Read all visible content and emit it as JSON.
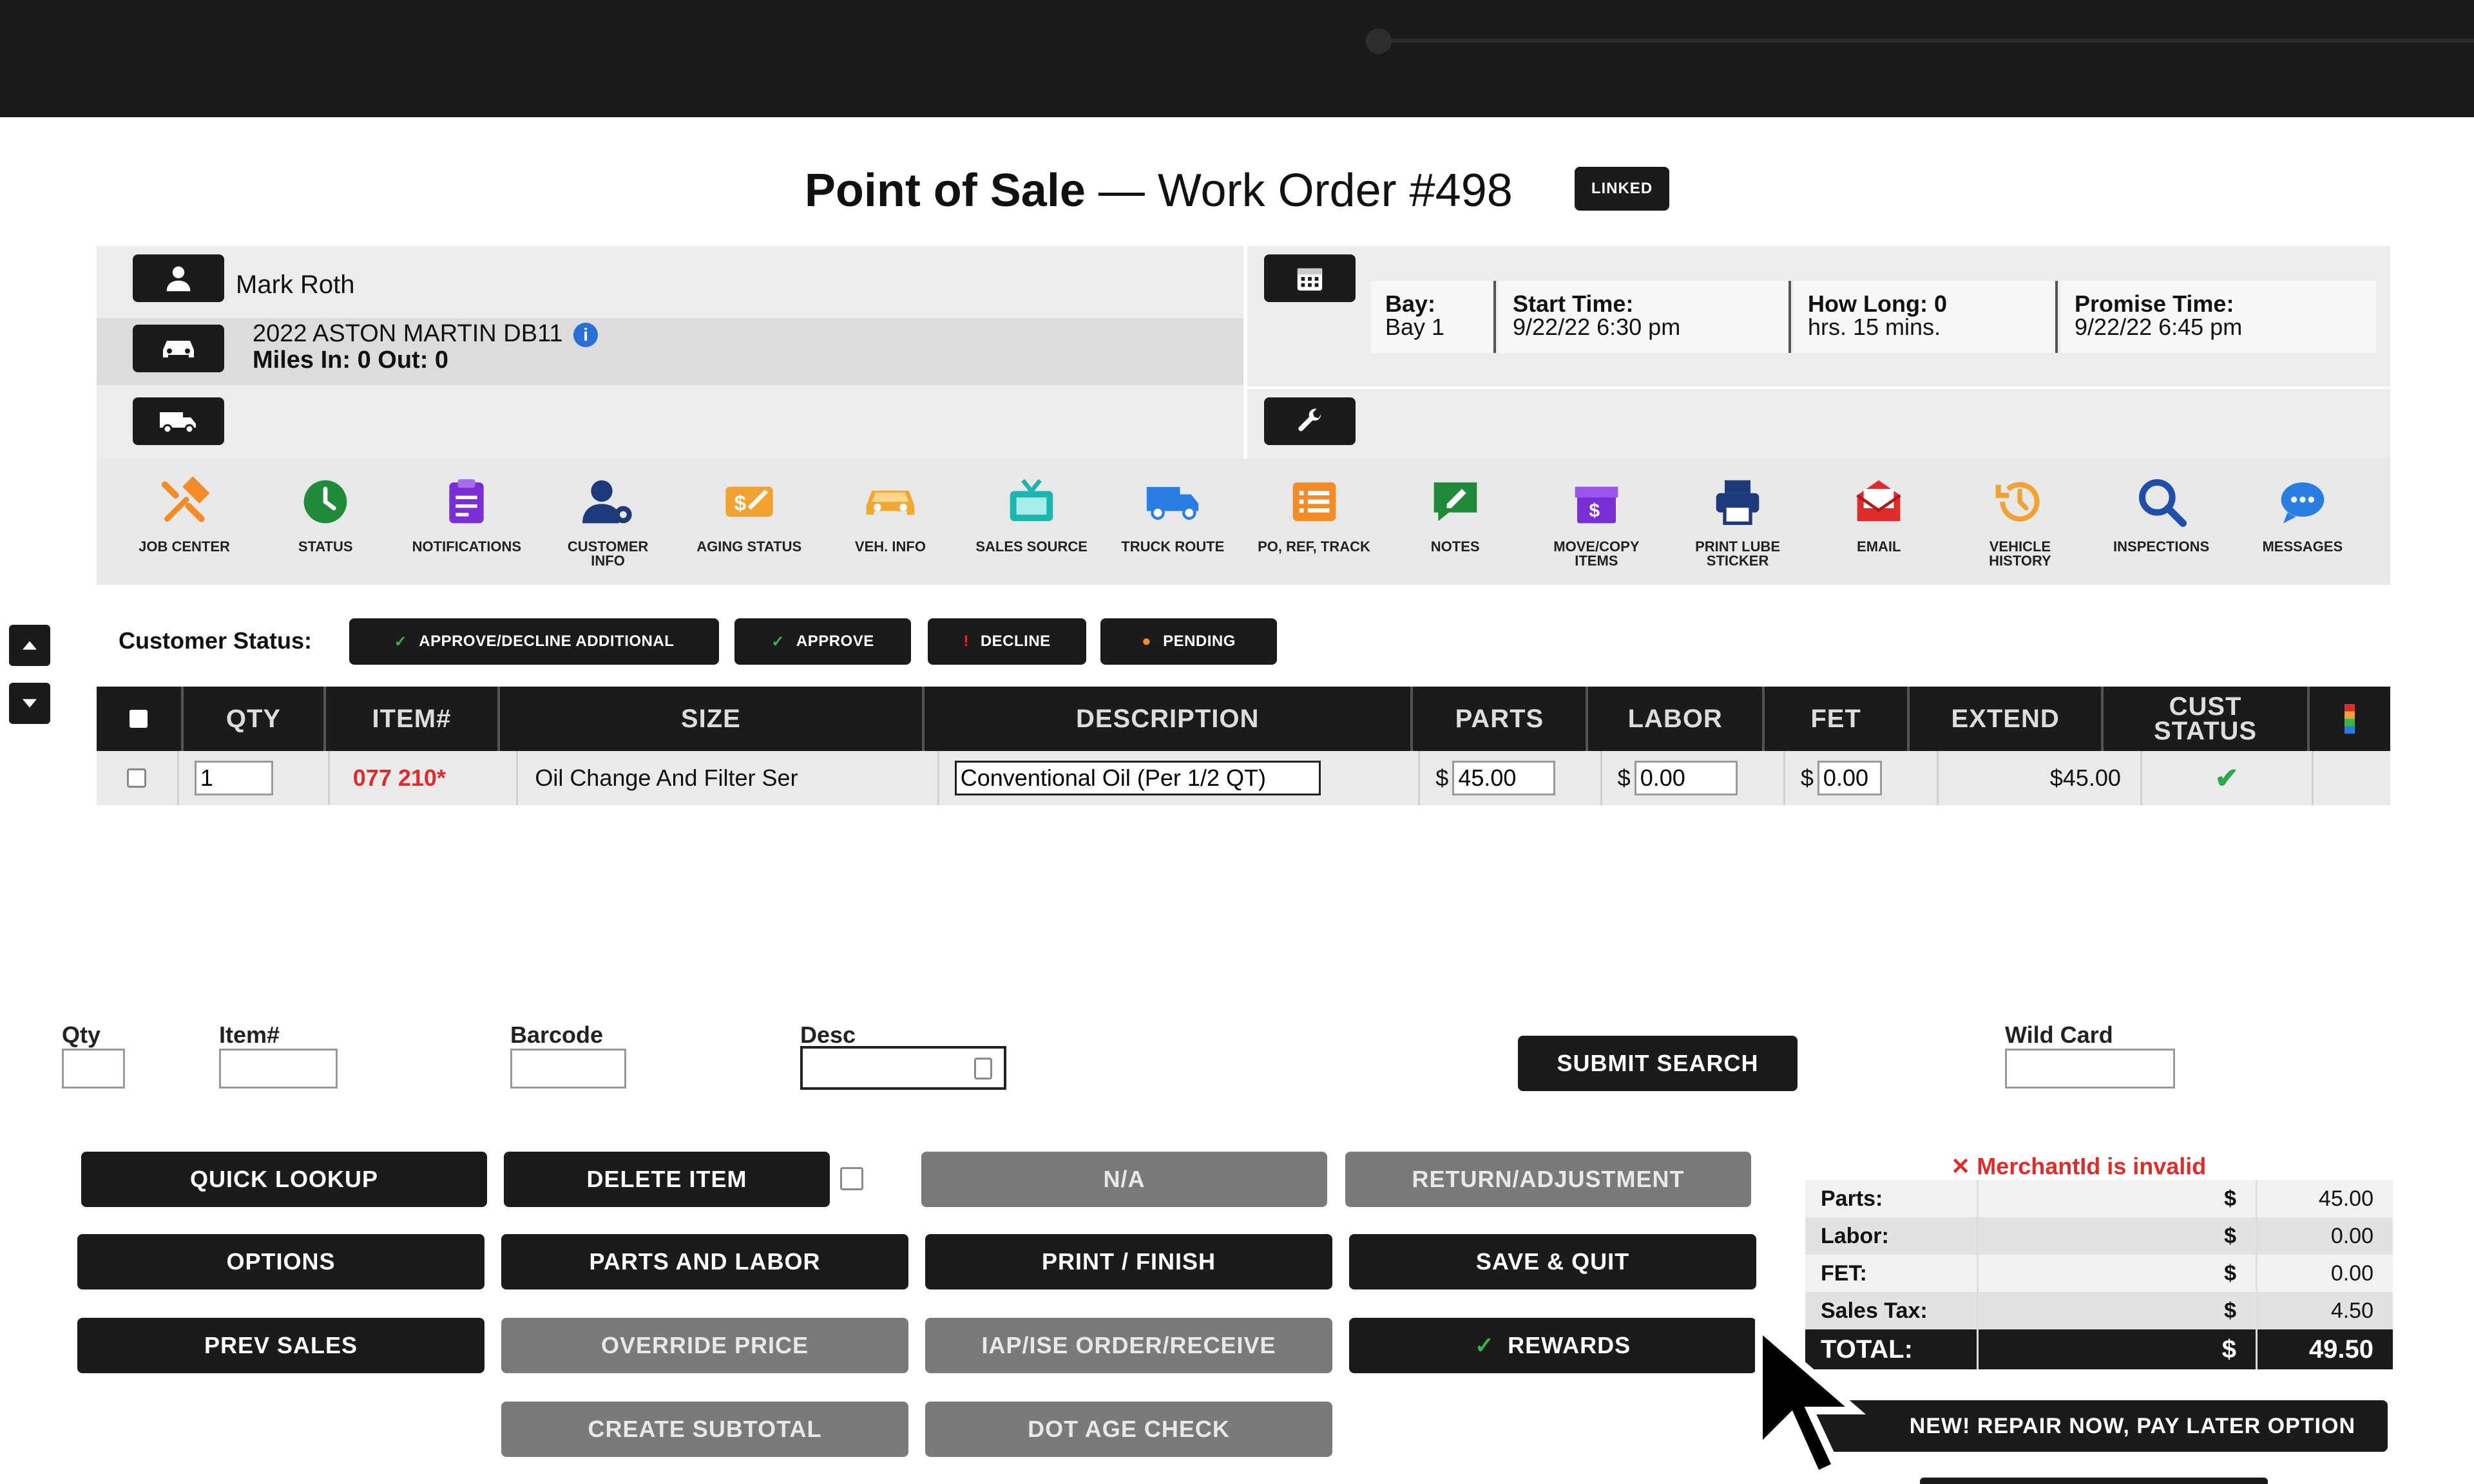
{
  "header": {
    "title_bold": "Point of Sale",
    "title_rest": "— Work Order #498",
    "badge": "LINKED"
  },
  "customer": {
    "name": "Mark Roth",
    "vehicle": "2022 ASTON MARTIN DB11",
    "miles": "Miles In: 0  Out: 0"
  },
  "schedule": {
    "bay_label": "Bay:",
    "bay_value": "Bay 1",
    "start_label": "Start Time:",
    "start_value": "9/22/22 6:30 pm",
    "howlong_label": "How Long: 0",
    "howlong_value": "hrs. 15 mins.",
    "promise_label": "Promise Time:",
    "promise_value": "9/22/22 6:45 pm"
  },
  "toolbar": [
    {
      "label": "JOB CENTER",
      "icon": "tools-icon",
      "color": "#f28c28"
    },
    {
      "label": "STATUS",
      "icon": "clock-icon",
      "color": "#1e8a3a"
    },
    {
      "label": "NOTIFICATIONS",
      "icon": "clipboard-icon",
      "color": "#7a2fd6"
    },
    {
      "label": "CUSTOMER INFO",
      "icon": "user-gear-icon",
      "color": "#1f3a7a"
    },
    {
      "label": "AGING STATUS",
      "icon": "money-icon",
      "color": "#f2a233"
    },
    {
      "label": "VEH. INFO",
      "icon": "car-icon",
      "color": "#f0a833"
    },
    {
      "label": "SALES SOURCE",
      "icon": "tv-icon",
      "color": "#1cb5b0"
    },
    {
      "label": "TRUCK ROUTE",
      "icon": "truck-icon",
      "color": "#2a7de1"
    },
    {
      "label": "PO, REF, TRACK",
      "icon": "list-icon",
      "color": "#f28c28"
    },
    {
      "label": "NOTES",
      "icon": "note-icon",
      "color": "#1e8a3a"
    },
    {
      "label": "MOVE/COPY ITEMS",
      "icon": "gift-icon",
      "color": "#7a2fd6"
    },
    {
      "label": "PRINT LUBE STICKER",
      "icon": "printer-icon",
      "color": "#1f3a7a"
    },
    {
      "label": "EMAIL",
      "icon": "mail-icon",
      "color": "#e02b2b"
    },
    {
      "label": "VEHICLE HISTORY",
      "icon": "history-icon",
      "color": "#f2a233"
    },
    {
      "label": "INSPECTIONS",
      "icon": "search-icon",
      "color": "#1f4fa8"
    },
    {
      "label": "MESSAGES",
      "icon": "chat-icon",
      "color": "#2a7de1"
    }
  ],
  "status_bar": {
    "label": "Customer Status:",
    "buttons": [
      {
        "label": "APPROVE/DECLINE ADDITIONAL",
        "mark": "✓",
        "mark_color": "#39b54a"
      },
      {
        "label": "APPROVE",
        "mark": "✓",
        "mark_color": "#39b54a"
      },
      {
        "label": "DECLINE",
        "mark": "!",
        "mark_color": "#e02b2b"
      },
      {
        "label": "PENDING",
        "mark": "●",
        "mark_color": "#f28c28"
      }
    ]
  },
  "table": {
    "headers": [
      "QTY",
      "ITEM#",
      "SIZE",
      "DESCRIPTION",
      "PARTS",
      "LABOR",
      "FET",
      "EXTEND",
      "CUST STATUS"
    ],
    "rows": [
      {
        "qty": "1",
        "item": "077 210*",
        "size": "Oil Change And Filter Ser",
        "description": "Conventional Oil (Per 1/2 QT)",
        "parts": "45.00",
        "labor": "0.00",
        "fet": "0.00",
        "extend": "$45.00",
        "status": "✔"
      }
    ],
    "currency": "$"
  },
  "search": {
    "qty_label": "Qty",
    "item_label": "Item#",
    "barcode_label": "Barcode",
    "desc_label": "Desc",
    "submit": "SUBMIT SEARCH",
    "wildcard_label": "Wild Card"
  },
  "actions": {
    "quick_lookup": "QUICK LOOKUP",
    "delete_item": "DELETE ITEM",
    "na": "N/A",
    "return_adjustment": "RETURN/ADJUSTMENT",
    "options": "OPTIONS",
    "parts_and_labor": "PARTS AND LABOR",
    "print_finish": "PRINT / FINISH",
    "save_quit": "SAVE & QUIT",
    "prev_sales": "PREV SALES",
    "override_price": "OVERRIDE PRICE",
    "iap_ise": "IAP/ISE ORDER/RECEIVE",
    "rewards": "REWARDS",
    "create_subtotal": "CREATE SUBTOTAL",
    "dot_age_check": "DOT AGE CHECK"
  },
  "totals": {
    "error": "MerchantId is invalid",
    "error_mark": "✕",
    "rows": [
      {
        "label": "Parts:",
        "currency": "$",
        "value": "45.00"
      },
      {
        "label": "Labor:",
        "currency": "$",
        "value": "0.00"
      },
      {
        "label": "FET:",
        "currency": "$",
        "value": "0.00"
      },
      {
        "label": "Sales Tax:",
        "currency": "$",
        "value": "4.50"
      }
    ],
    "total_label": "TOTAL:",
    "total_currency": "$",
    "total_value": "49.50",
    "promo": "NEW! REPAIR NOW, PAY LATER OPTION"
  }
}
